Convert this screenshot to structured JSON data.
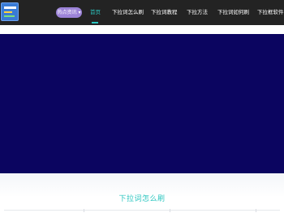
{
  "header": {
    "badge": "热点资讯 ▾",
    "nav": [
      {
        "label": "首页"
      },
      {
        "label": "下拉词怎么刷"
      },
      {
        "label": "下拉词教程"
      },
      {
        "label": "下拉方法"
      },
      {
        "label": "下拉词如何刷"
      },
      {
        "label": "下拉框软件"
      }
    ]
  },
  "section": {
    "title": "下拉词怎么刷"
  },
  "colors": {
    "header_bg": "#232323",
    "accent": "#2cc6c0",
    "badge_bg": "#9c83d8",
    "banner_bg": "#0b0560"
  }
}
